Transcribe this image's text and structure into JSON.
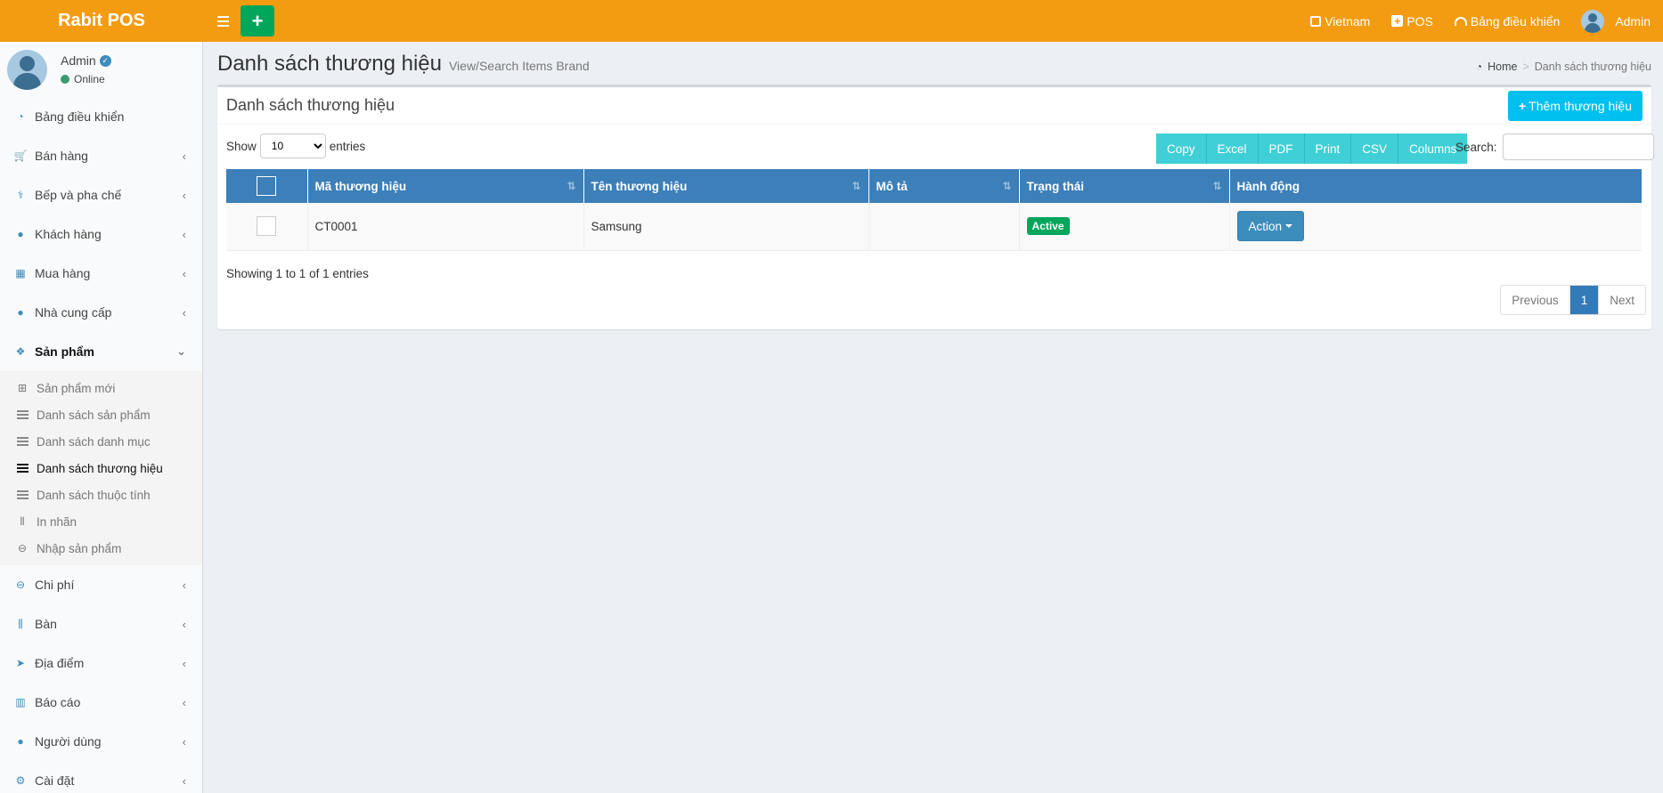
{
  "header": {
    "logo": "Rabit POS",
    "language": "Vietnam",
    "pos": "POS",
    "dashboard": "Bảng điều khiển",
    "user": "Admin"
  },
  "sidebar": {
    "user_name": "Admin",
    "user_status": "Online",
    "menu_top": [
      {
        "label": "Bảng điều khiển",
        "icon": "dashboard-icon"
      },
      {
        "label": "Bán hàng",
        "icon": "cart-icon"
      },
      {
        "label": "Bếp và pha chế",
        "icon": "kitchen-icon"
      },
      {
        "label": "Khách hàng",
        "icon": "users-icon"
      },
      {
        "label": "Mua hàng",
        "icon": "grid-icon"
      },
      {
        "label": "Nhà cung cấp",
        "icon": "user-plus-icon"
      },
      {
        "label": "Sản phẩm",
        "icon": "cubes-icon"
      }
    ],
    "submenu": [
      {
        "label": "Sản phẩm mới",
        "icon": "plus-square-icon"
      },
      {
        "label": "Danh sách sản phẩm",
        "icon": "list-icon"
      },
      {
        "label": "Danh sách danh mục",
        "icon": "list-icon"
      },
      {
        "label": "Danh sách thương hiệu",
        "icon": "list-icon"
      },
      {
        "label": "Danh sách thuộc tính",
        "icon": "list-icon"
      },
      {
        "label": "In nhãn",
        "icon": "barcode-icon"
      },
      {
        "label": "Nhập sản phẩm",
        "icon": "import-icon"
      }
    ],
    "menu_bottom": [
      {
        "label": "Chi phí",
        "icon": "minus-circle-icon"
      },
      {
        "label": "Bàn",
        "icon": "cutlery-icon"
      },
      {
        "label": "Địa điểm",
        "icon": "paper-plane-icon"
      },
      {
        "label": "Báo cáo",
        "icon": "bar-chart-icon"
      },
      {
        "label": "Người dùng",
        "icon": "users-icon"
      },
      {
        "label": "Cài đặt",
        "icon": "gears-icon"
      }
    ]
  },
  "page": {
    "title": "Danh sách thương hiệu",
    "subtitle": "View/Search Items Brand",
    "breadcrumb_home": "Home",
    "breadcrumb_current": "Danh sách thương hiệu"
  },
  "box": {
    "title": "Danh sách thương hiệu",
    "add_button": "Thêm thương hiệu"
  },
  "table_controls": {
    "show_label": "Show",
    "entries_value": "10",
    "entries_label": "entries",
    "buttons": [
      "Copy",
      "Excel",
      "PDF",
      "Print",
      "CSV",
      "Columns"
    ],
    "search_label": "Search:"
  },
  "table": {
    "columns": [
      "Mã thương hiệu",
      "Tên thương hiệu",
      "Mô tả",
      "Trạng thái",
      "Hành động"
    ],
    "rows": [
      {
        "code": "CT0001",
        "name": "Samsung",
        "description": "",
        "status": "Active",
        "action": "Action"
      }
    ]
  },
  "footer_info": "Showing 1 to 1 of 1 entries",
  "pagination": {
    "previous": "Previous",
    "current": "1",
    "next": "Next"
  },
  "colors": {
    "header_bg": "#f39c12",
    "add_green": "#00a65a",
    "table_head": "#3c7fb9",
    "export_buttons": "#40cfd6",
    "add_brand_button": "#00c0ef"
  }
}
